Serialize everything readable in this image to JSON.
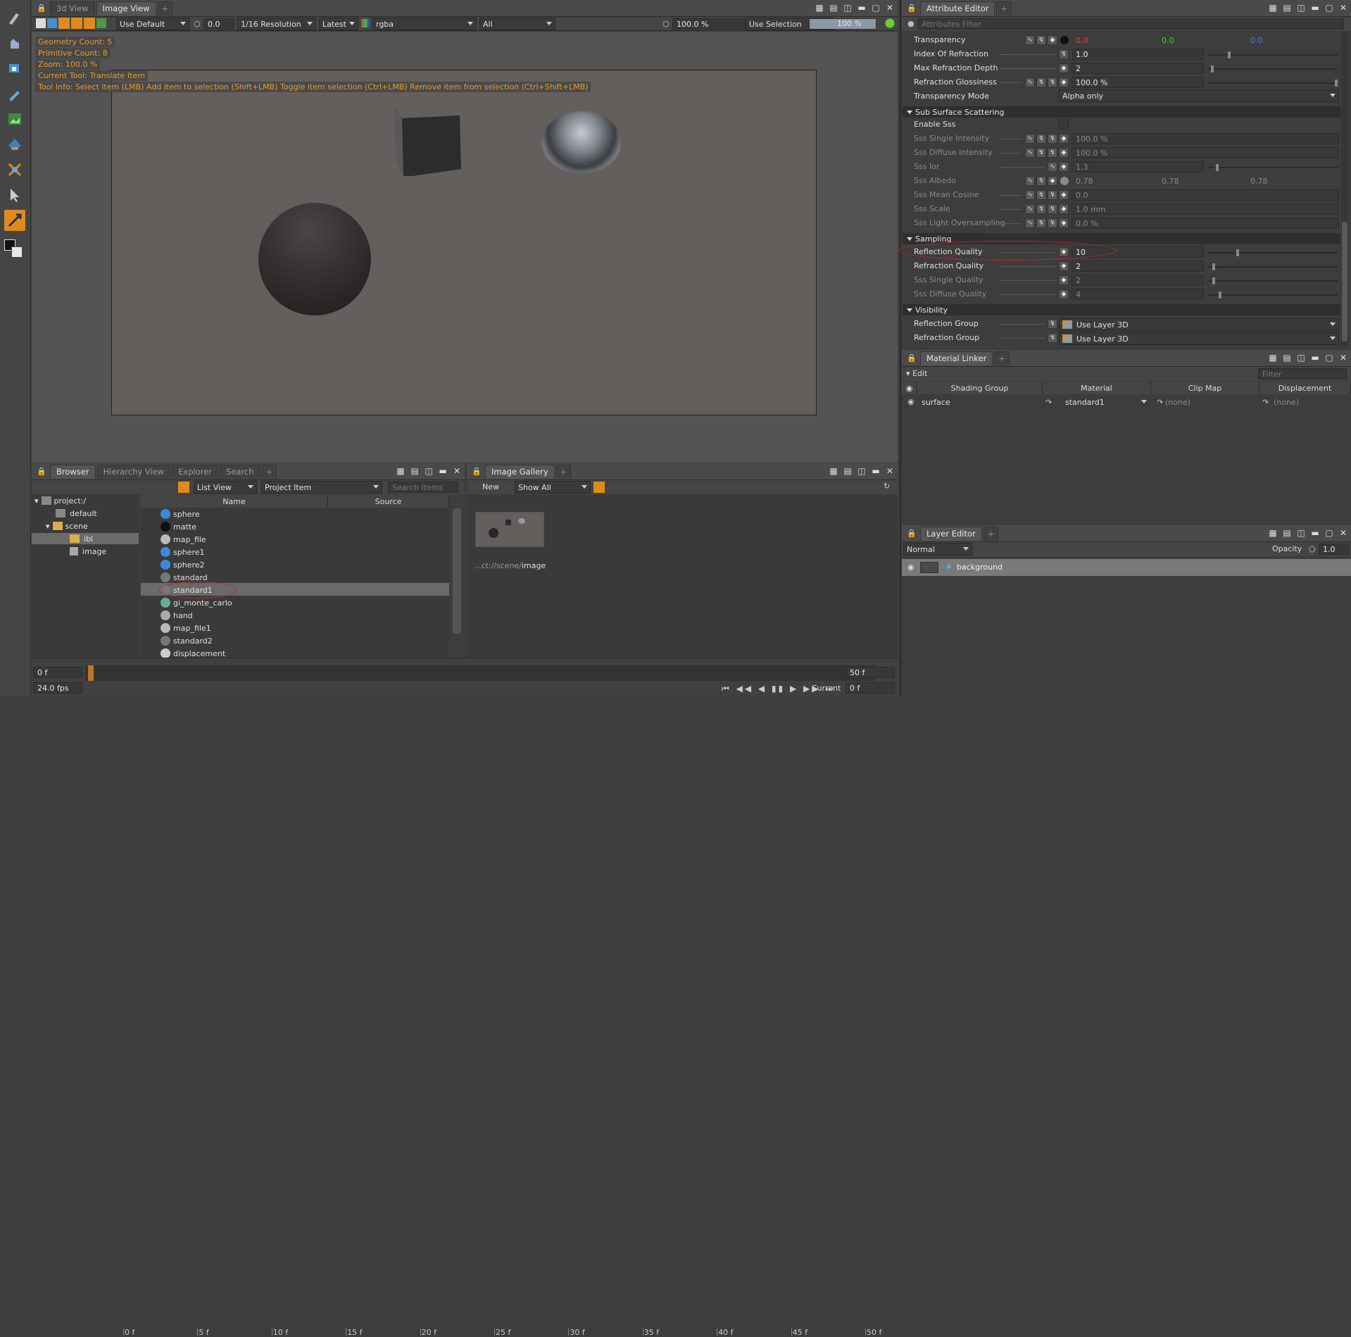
{
  "viewport": {
    "tabs": [
      "3d View",
      "Image View"
    ],
    "display_combo": "Use Default",
    "exposure_value": "0.0",
    "resolution_combo": "1/16 Resolution",
    "version_combo": "Latest",
    "channel_combo": "rgba",
    "layer_combo": "All",
    "zoom_value": "100.0 %",
    "selection_combo": "Use Selection",
    "progress_label": "100 %",
    "hud": {
      "geometry_count": "Geometry Count: 5",
      "primitive_count": "Primitive Count: 8",
      "zoom": "Zoom: 100.0 %",
      "current_tool": "Current Tool: Translate Item",
      "tool_info": "Tool Info: Select item (LMB)  Add item to selection (Shift+LMB)  Toggle item selection (Ctrl+LMB)  Remove item from selection (Ctrl+Shift+LMB)"
    }
  },
  "browser": {
    "tabs": [
      "Browser",
      "Hierarchy View",
      "Explorer",
      "Search"
    ],
    "view_combo": "List View",
    "filter_combo": "Project Item",
    "search_placeholder": "Search Items",
    "tree": [
      {
        "label": "project:/",
        "level": 0
      },
      {
        "label": "default",
        "level": 1
      },
      {
        "label": "scene",
        "level": 1
      },
      {
        "label": "ibl",
        "level": 2
      },
      {
        "label": "image",
        "level": 2
      }
    ],
    "columns": [
      "Name",
      "Source"
    ],
    "items": [
      "sphere",
      "matte",
      "map_file",
      "sphere1",
      "sphere2",
      "standard",
      "standard1",
      "gi_monte_carlo",
      "hand",
      "map_file1",
      "standard2",
      "displacement"
    ],
    "selected_item": "standard1"
  },
  "gallery": {
    "tab": "Image Gallery",
    "new_label": "New",
    "show_combo": "Show All",
    "thumb_caption_prefix": "...ct://scene/",
    "thumb_caption_name": "image"
  },
  "timeline": {
    "start": "0 f",
    "end": "50 f",
    "fps": "24.0 fps",
    "current_label": "Current",
    "current_value": "0 f",
    "ticks": [
      "0 f",
      "5 f",
      "10 f",
      "15 f",
      "20 f",
      "25 f",
      "30 f",
      "35 f",
      "40 f",
      "45 f",
      "50 f"
    ]
  },
  "attribute_editor": {
    "tab": "Attribute Editor",
    "filter_placeholder": "Attributes Filter",
    "transparency": {
      "label": "Transparency",
      "r": "0.0",
      "g": "0.0",
      "b": "0.0"
    },
    "ior": {
      "label": "Index Of Refraction",
      "value": "1.0"
    },
    "max_depth": {
      "label": "Max Refraction Depth",
      "value": "2"
    },
    "glossiness": {
      "label": "Refraction Glossiness",
      "value": "100.0 %"
    },
    "mode": {
      "label": "Transparency Mode",
      "value": "Alpha only"
    },
    "sss_section": "Sub Surface Scattering",
    "enable_sss": "Enable Sss",
    "sss_single_intensity": {
      "label": "Sss Single Intensity",
      "value": "100.0 %"
    },
    "sss_diffuse_intensity": {
      "label": "Sss Diffuse Intensity",
      "value": "100.0 %"
    },
    "sss_ior": {
      "label": "Sss Ior",
      "value": "1.3"
    },
    "sss_albedo": {
      "label": "Sss Albedo",
      "r": "0.78",
      "g": "0.78",
      "b": "0.78"
    },
    "sss_mean_cosine": {
      "label": "Sss Mean Cosine",
      "value": "0.0"
    },
    "sss_scale": {
      "label": "Sss Scale",
      "value": "1.0 mm"
    },
    "sss_light_oversampling": {
      "label": "Sss Light Oversampling",
      "value": "0.0 %"
    },
    "sampling_section": "Sampling",
    "reflection_quality": {
      "label": "Reflection Quality",
      "value": "10"
    },
    "refraction_quality": {
      "label": "Refraction Quality",
      "value": "2"
    },
    "sss_single_quality": {
      "label": "Sss Single Quality",
      "value": "2"
    },
    "sss_diffuse_quality": {
      "label": "Sss Diffuse Quality",
      "value": "4"
    },
    "visibility_section": "Visibility",
    "reflection_group": {
      "label": "Reflection Group",
      "value": "Use Layer 3D"
    },
    "refraction_group": {
      "label": "Refraction Group",
      "value": "Use Layer 3D"
    }
  },
  "material_linker": {
    "tab": "Material Linker",
    "edit_label": "Edit",
    "filter_placeholder": "Filter",
    "columns": [
      "Shading Group",
      "Material",
      "Clip Map",
      "Displacement"
    ],
    "row": {
      "group": "surface",
      "material": "standard1",
      "clip": "(none)",
      "displacement": "(none)"
    }
  },
  "layer_editor": {
    "tab": "Layer Editor",
    "blend_combo": "Normal",
    "opacity_label": "Opacity",
    "opacity_value": "1.0",
    "layer_name": "background"
  },
  "colors": {
    "accent": "#e08a1e",
    "annotation": "#c0282a",
    "hud_text": "#e89a2a"
  }
}
